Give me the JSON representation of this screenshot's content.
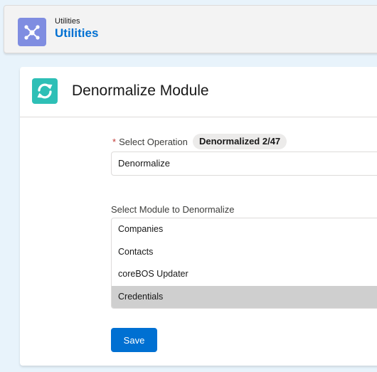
{
  "header": {
    "subtitle": "Utilities",
    "title": "Utilities",
    "icon": "share-network-icon",
    "icon_color": "#7f8de1"
  },
  "card": {
    "title": "Denormalize Module",
    "icon": "refresh-icon",
    "icon_color": "#2ebfb6"
  },
  "form": {
    "required_marker": "*",
    "operation_label": "Select Operation",
    "operation_badge": "Denormalized 2/47",
    "operation_value": "Denormalize",
    "module_label": "Select Module to Denormalize",
    "module_options": [
      {
        "label": "Companies",
        "selected": false
      },
      {
        "label": "Contacts",
        "selected": false
      },
      {
        "label": "coreBOS Updater",
        "selected": false
      },
      {
        "label": "Credentials",
        "selected": true
      }
    ],
    "save_label": "Save"
  },
  "colors": {
    "brand": "#0070d2",
    "selected_option_bg": "#cfcfcf"
  }
}
